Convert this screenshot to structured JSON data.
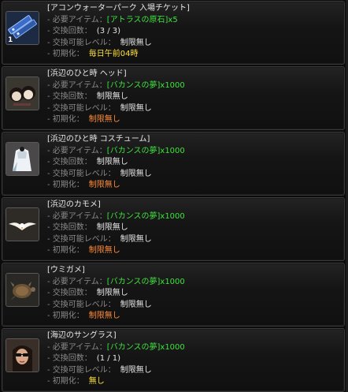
{
  "labels": {
    "required_item": "- 必要アイテム：",
    "exchange_count": "- 交換回数：",
    "exchange_level": "- 交換可能レベル：",
    "reset": "- 初期化："
  },
  "entries": [
    {
      "title": "[アコンウォーターパーク 入場チケット]",
      "item": "[アトラスの原石]",
      "item_qty": "x5",
      "count": "(3 / 3)",
      "level": "制限無し",
      "reset": "毎日午前04時",
      "icon": "ticket-icon",
      "stack": "1"
    },
    {
      "title": "[浜辺のひと時 ヘッド]",
      "item": "[バカンスの夢]",
      "item_qty": "x1000",
      "count": "制限無し",
      "level": "制限無し",
      "reset": "制限無し",
      "icon": "head-accessory-icon",
      "stack": ""
    },
    {
      "title": "[浜辺のひと時 コスチューム]",
      "item": "[バカンスの夢]",
      "item_qty": "x1000",
      "count": "制限無し",
      "level": "制限無し",
      "reset": "制限無し",
      "icon": "costume-icon",
      "stack": ""
    },
    {
      "title": "[浜辺のカモメ]",
      "item": "[バカンスの夢]",
      "item_qty": "x1000",
      "count": "制限無し",
      "level": "制限無し",
      "reset": "制限無し",
      "icon": "seagull-icon",
      "stack": ""
    },
    {
      "title": "[ウミガメ]",
      "item": "[バカンスの夢]",
      "item_qty": "x1000",
      "count": "制限無し",
      "level": "制限無し",
      "reset": "制限無し",
      "icon": "sea-turtle-icon",
      "stack": ""
    },
    {
      "title": "[海辺のサングラス]",
      "item": "[バカンスの夢]",
      "item_qty": "x1000",
      "count": "(1 / 1)",
      "level": "制限無し",
      "reset": "無し",
      "icon": "sunglasses-icon",
      "stack": ""
    }
  ],
  "colors": {
    "title": "#e8e8e8",
    "label": "#8a8a8a",
    "required_item": "#3ee23e",
    "value": "#e6e6e6",
    "reset_value": "#ff8c3a",
    "daily_reset": "#ffe23a"
  }
}
